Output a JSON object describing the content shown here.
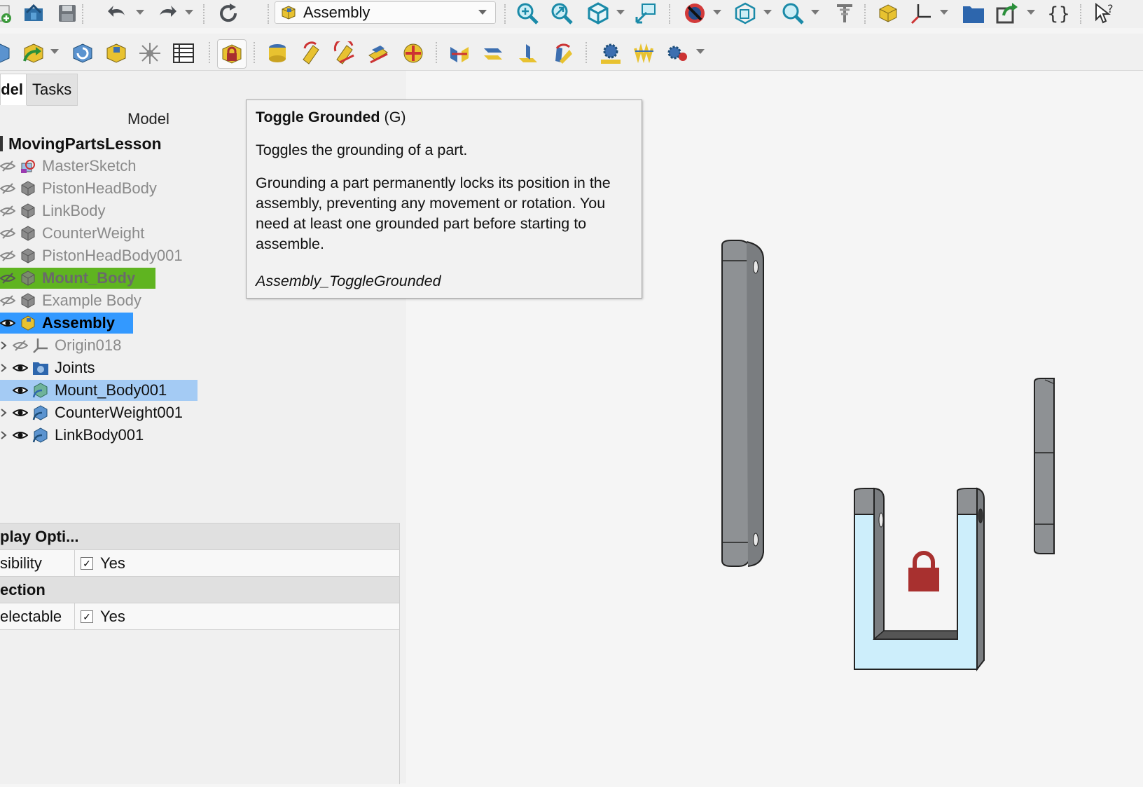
{
  "workbench_selector": {
    "value": "Assembly"
  },
  "tabs": [
    {
      "label": "del"
    },
    {
      "label": "Tasks"
    }
  ],
  "tree": {
    "header": "Model",
    "root": "MovingPartsLesson",
    "items": [
      {
        "label": "MasterSketch",
        "icon": "sketch-icon",
        "visible": false
      },
      {
        "label": "PistonHeadBody",
        "icon": "body-icon",
        "visible": false
      },
      {
        "label": "LinkBody",
        "icon": "body-icon",
        "visible": false
      },
      {
        "label": "CounterWeight",
        "icon": "body-icon",
        "visible": false
      },
      {
        "label": "PistonHeadBody001",
        "icon": "body-icon",
        "visible": false
      },
      {
        "label": "Mount_Body",
        "icon": "body-icon",
        "visible": false,
        "highlight": "#5fb420"
      },
      {
        "label": "Example Body",
        "icon": "body-icon",
        "visible": false
      },
      {
        "label": "Assembly",
        "icon": "assembly-icon",
        "visible": true,
        "highlight": "#3399ff"
      }
    ],
    "children": [
      {
        "label": "Origin018",
        "icon": "origin-icon",
        "visible": false
      },
      {
        "label": "Joints",
        "icon": "joints-folder-icon",
        "visible": true
      },
      {
        "label": "Mount_Body001",
        "icon": "link-body-icon",
        "visible": true,
        "highlight": "#a4cbf4"
      },
      {
        "label": "CounterWeight001",
        "icon": "link-body-icon",
        "visible": true
      },
      {
        "label": "LinkBody001",
        "icon": "link-body-icon",
        "visible": true
      }
    ]
  },
  "properties": {
    "group1": "play Opti...",
    "row1": {
      "name": "sibility",
      "value": "Yes",
      "checked": true
    },
    "group2": "ection",
    "row2": {
      "name": "electable",
      "value": "Yes",
      "checked": true
    }
  },
  "tooltip": {
    "title": "Toggle Grounded",
    "shortcut": "(G)",
    "line1": "Toggles the grounding of a part.",
    "line2": "Grounding a part permanently locks its position in the assembly, preventing any movement or rotation. You need at least one grounded part before starting to assemble.",
    "command": "Assembly_ToggleGrounded"
  },
  "colors": {
    "part_grey": "#8e9194",
    "grounded_part_fill": "#cdeefb",
    "lock_red": "#a8302f",
    "selection_blue": "#3399ff",
    "preselect_green": "#5fb420"
  },
  "toolbar1_icons": [
    "new-part-icon",
    "open-icon",
    "save-icon",
    "undo-icon",
    "redo-icon",
    "refresh-icon",
    "fit-all-icon",
    "fit-selection-icon",
    "isometric-view-icon",
    "measure-icon",
    "draw-style-icon",
    "bounding-box-icon",
    "zoom-icon",
    "dimension-icon",
    "part-icon",
    "origin-axis-icon",
    "group-folder-icon",
    "export-icon",
    "macro-braces-icon",
    "whats-this-icon"
  ],
  "toolbar2_icons": [
    "body-icon",
    "link-icon",
    "reload-icon",
    "create-assembly-icon",
    "exploded-view-icon",
    "bom-spreadsheet-icon",
    "toggle-grounded-icon",
    "fixed-joint-icon",
    "revolute-joint-icon",
    "cylindrical-joint-icon",
    "slider-joint-icon",
    "ball-joint-icon",
    "distance-joint-icon",
    "parallel-joint-icon",
    "perpendicular-joint-icon",
    "angle-joint-icon",
    "rack-pinion-icon",
    "screw-joint-icon",
    "gears-icon"
  ]
}
